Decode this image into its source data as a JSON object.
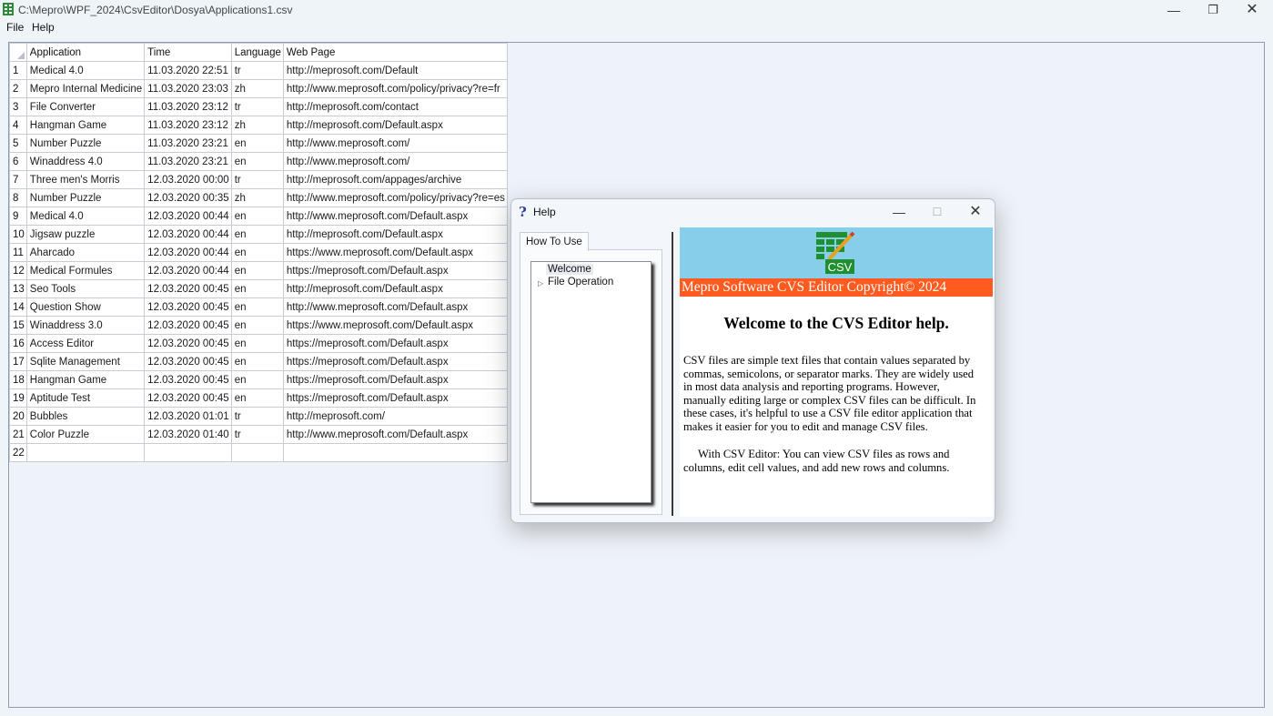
{
  "window": {
    "title": "C:\\Mepro\\WPF_2024\\CsvEditor\\Dosya\\Applications1.csv",
    "min_glyph": "—",
    "max_glyph": "❐",
    "close_glyph": "✕"
  },
  "menu": {
    "file": "File",
    "help": "Help"
  },
  "grid": {
    "columns": [
      "Application",
      "Time",
      "Language",
      "Web Page"
    ],
    "rows": [
      {
        "n": "1",
        "app": "Medical 4.0",
        "time": "11.03.2020 22:51",
        "lang": "tr",
        "web": "http://meprosoft.com/Default"
      },
      {
        "n": "2",
        "app": "Mepro Internal Medicine",
        "time": "11.03.2020 23:03",
        "lang": "zh",
        "web": "http://www.meprosoft.com/policy/privacy?re=fr"
      },
      {
        "n": "3",
        "app": "File Converter",
        "time": "11.03.2020 23:12",
        "lang": "tr",
        "web": "http://meprosoft.com/contact"
      },
      {
        "n": "4",
        "app": "Hangman Game",
        "time": "11.03.2020 23:12",
        "lang": "zh",
        "web": "http://meprosoft.com/Default.aspx"
      },
      {
        "n": "5",
        "app": "Number Puzzle",
        "time": "11.03.2020 23:21",
        "lang": "en",
        "web": "http://www.meprosoft.com/"
      },
      {
        "n": "6",
        "app": "Winaddress 4.0",
        "time": "11.03.2020 23:21",
        "lang": "en",
        "web": "http://www.meprosoft.com/"
      },
      {
        "n": "7",
        "app": "Three men's Morris",
        "time": "12.03.2020 00:00",
        "lang": "tr",
        "web": "http://meprosoft.com/appages/archive"
      },
      {
        "n": "8",
        "app": "Number Puzzle",
        "time": "12.03.2020 00:35",
        "lang": "zh",
        "web": "http://www.meprosoft.com/policy/privacy?re=es"
      },
      {
        "n": "9",
        "app": "Medical 4.0",
        "time": "12.03.2020 00:44",
        "lang": "en",
        "web": "http://www.meprosoft.com/Default.aspx"
      },
      {
        "n": "10",
        "app": "Jigsaw puzzle",
        "time": "12.03.2020 00:44",
        "lang": "en",
        "web": "http://meprosoft.com/Default.aspx"
      },
      {
        "n": "11",
        "app": "Aharcado",
        "time": "12.03.2020 00:44",
        "lang": "en",
        "web": "https://www.meprosoft.com/Default.aspx"
      },
      {
        "n": "12",
        "app": "Medical Formules",
        "time": "12.03.2020 00:44",
        "lang": "en",
        "web": "https://meprosoft.com/Default.aspx"
      },
      {
        "n": "13",
        "app": "Seo Tools",
        "time": "12.03.2020 00:45",
        "lang": "en",
        "web": "http://meprosoft.com/Default.aspx"
      },
      {
        "n": "14",
        "app": "Question Show",
        "time": "12.03.2020 00:45",
        "lang": "en",
        "web": "http://www.meprosoft.com/Default.aspx"
      },
      {
        "n": "15",
        "app": "Winaddress 3.0",
        "time": "12.03.2020 00:45",
        "lang": "en",
        "web": "https://www.meprosoft.com/Default.aspx"
      },
      {
        "n": "16",
        "app": "Access Editor",
        "time": "12.03.2020 00:45",
        "lang": "en",
        "web": "https://meprosoft.com/Default.aspx"
      },
      {
        "n": "17",
        "app": "Sqlite Management",
        "time": "12.03.2020 00:45",
        "lang": "en",
        "web": "https://meprosoft.com/Default.aspx"
      },
      {
        "n": "18",
        "app": "Hangman Game",
        "time": "12.03.2020 00:45",
        "lang": "en",
        "web": "https://meprosoft.com/Default.aspx"
      },
      {
        "n": "19",
        "app": "Aptitude Test",
        "time": "12.03.2020 00:45",
        "lang": "en",
        "web": "https://meprosoft.com/Default.aspx"
      },
      {
        "n": "20",
        "app": "Bubbles",
        "time": "12.03.2020 01:01",
        "lang": "tr",
        "web": "http://meprosoft.com/"
      },
      {
        "n": "21",
        "app": "Color Puzzle",
        "time": "12.03.2020 01:40",
        "lang": "tr",
        "web": "http://www.meprosoft.com/Default.aspx"
      },
      {
        "n": "22",
        "app": "",
        "time": "",
        "lang": "",
        "web": ""
      }
    ]
  },
  "help_dialog": {
    "title": "Help",
    "title_icon": "?",
    "min_glyph": "—",
    "max_glyph": "☐",
    "close_glyph": "✕",
    "tab_label": "How To Use",
    "tree": {
      "welcome": "Welcome",
      "file_operation": "File Operation",
      "expand_glyph": "▷"
    },
    "logo_text": "CSV",
    "banner_text": "Mepro Software CVS Editor Copyright© 2024",
    "heading": "Welcome to the CVS Editor help.",
    "paragraph1": "CSV files are simple text files that contain values separated by commas, semicolons, or separator marks. They are widely used in most data analysis and reporting programs. However, manually editing large or complex CSV files can be difficult. In these cases, it's helpful to use a CSV file editor application that makes it easier for you to edit and manage CSV files.",
    "paragraph2": "With CSV Editor: You can view CSV files as rows and columns, edit cell values, and add new rows and columns."
  },
  "colors": {
    "background": "#eff4f9",
    "banner_blue": "#87ceea",
    "banner_orange": "#ff5a1f",
    "logo_green": "#1f8f2f"
  }
}
